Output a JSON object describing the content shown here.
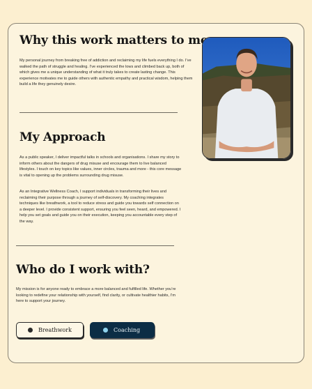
{
  "sections": {
    "why": {
      "title": "Why this work matters to me",
      "body": "My personal journey from breaking free of addiction and reclaiming my life fuels everything I do. I’ve walked the path of struggle and healing. I’ve experienced the lows and climbed back up, both of which gives me a unique understanding of what it truly takes to create lasting change. This experience motivates me to guide others with authentic empathy and practical wisdom, helping them build a life they genuinely desire."
    },
    "approach": {
      "title": "My Approach",
      "body1": "As a public speaker, I deliver impactful talks in schools and organisations. I share my story to inform others about the dangers of drug misuse and encourage them to live balanced lifestyles. I touch on key topics like values, inner circles, trauma and more - this core message is vital to opening up the problems surrounding drug misuse.",
      "body2": "As an Integrative Wellness Coach, I support individuals in transforming their lives and reclaiming their purpose through a journey of self-discovery. My coaching integrates techniques like breathwork, a tool to reduce stress and guide you towards self connection on a deeper level. I provide consistent support, ensuring you feel seen, heard, and empowered. I help you set goals and guide you on their execution, keeping you accountable every step of the way."
    },
    "who": {
      "title": "Who do I work with?",
      "body": "My mission is for anyone ready to embrace a more balanced and fulfilled life. Whether you’re looking to redefine your relationship with yourself, find clarity, or cultivate healthier habits, I’m here to support your journey."
    }
  },
  "buttons": {
    "breathwork": "Breathwork",
    "coaching": "Coaching"
  },
  "colors": {
    "page_background": "#fcefd0",
    "card_background": "#fcf4de",
    "coaching_button": "#0c2d45",
    "coaching_dot": "#8ed3ee"
  }
}
